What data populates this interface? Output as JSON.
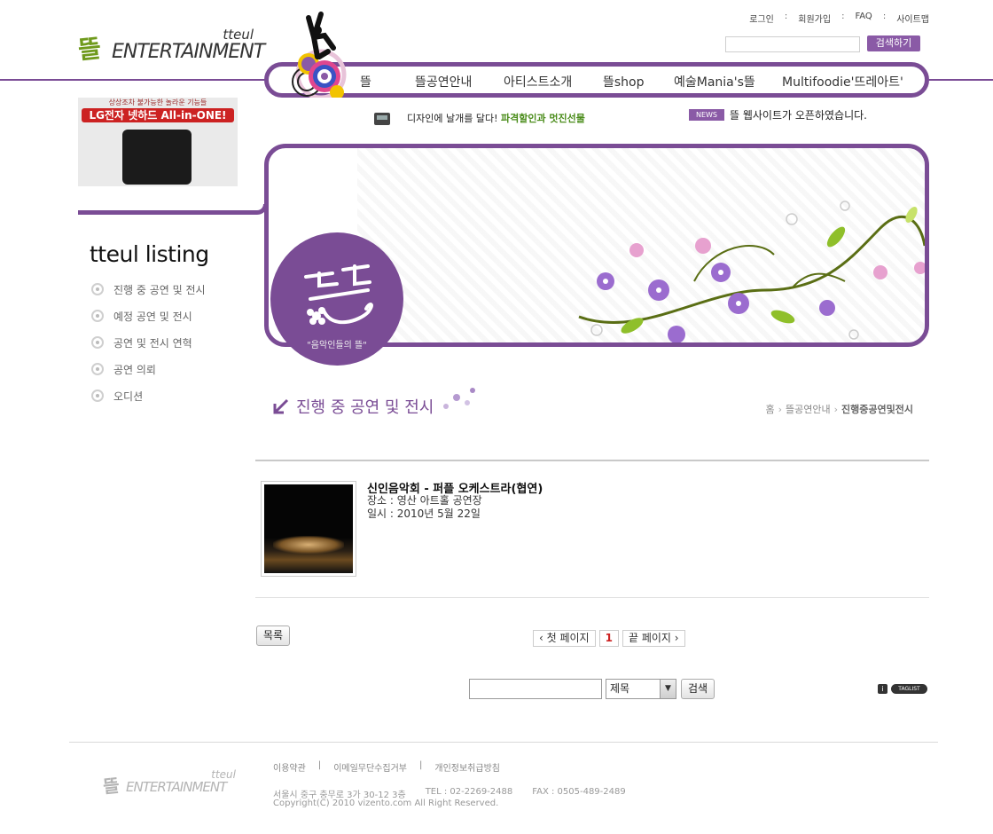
{
  "header": {
    "logo": {
      "mark": "뜰",
      "entertainment": "ENTERTAINMENT",
      "tteul": "tteul"
    },
    "top_links": [
      "로그인",
      "회원가입",
      "FAQ",
      "사이트맵"
    ],
    "search_button": "검색하기",
    "nav": [
      "뜰",
      "뜰공연안내",
      "아티스트소개",
      "뜰shop",
      "예술Mania's뜰",
      "Multifoodie'뜨레아트'"
    ]
  },
  "promo": {
    "text": "디자인에 날개를 달다!",
    "highlight": "파격할인과 멋진선물",
    "news_badge": "NEWS",
    "news_text": "뜰 웹사이트가 오픈하였습니다."
  },
  "ad": {
    "subtitle": "상상조차 불가능한 놀라운 기능들",
    "brand": "LG전자 넷하드 All-in-ONE!"
  },
  "sidebar": {
    "title": "tteul listing",
    "items": [
      "진행 중 공연 및 전시",
      "예정 공연 및 전시",
      "공연 및 전시 연혁",
      "공연 의뢰",
      "오디션"
    ]
  },
  "banner": {
    "badge_caption": "\"음악인들의 뜰\""
  },
  "page": {
    "heading": "진행 중 공연 및 전시",
    "breadcrumb": [
      "홈",
      "뜰공연안내",
      "진행중공연및전시"
    ]
  },
  "item": {
    "title": "신인음악회 - 퍼플 오케스트라(협연)",
    "place": "장소 : 영산 아트홀 공연장",
    "date": "일시 : 2010년 5월 22일"
  },
  "list_button": "목록",
  "pagination": {
    "first": "첫 페이지",
    "current": "1",
    "last": "끝 페이지"
  },
  "bottom_search": {
    "select_value": "제목",
    "button": "검색",
    "taglist": "TAGLIST",
    "info": "i"
  },
  "footer": {
    "links": [
      "이용약관",
      "이메일무단수집거부",
      "개인정보취급방침"
    ],
    "address": "서울시 중구 충무로 3가 30-12 3층",
    "tel": "TEL : 02-2269-2488",
    "fax": "FAX : 0505-489-2489",
    "copyright": "Copyright(C) 2010 vizento.com All Right Reserved."
  },
  "colors": {
    "accent": "#7a4c95",
    "green": "#6f9a1c",
    "news": "#8a5aa6"
  }
}
